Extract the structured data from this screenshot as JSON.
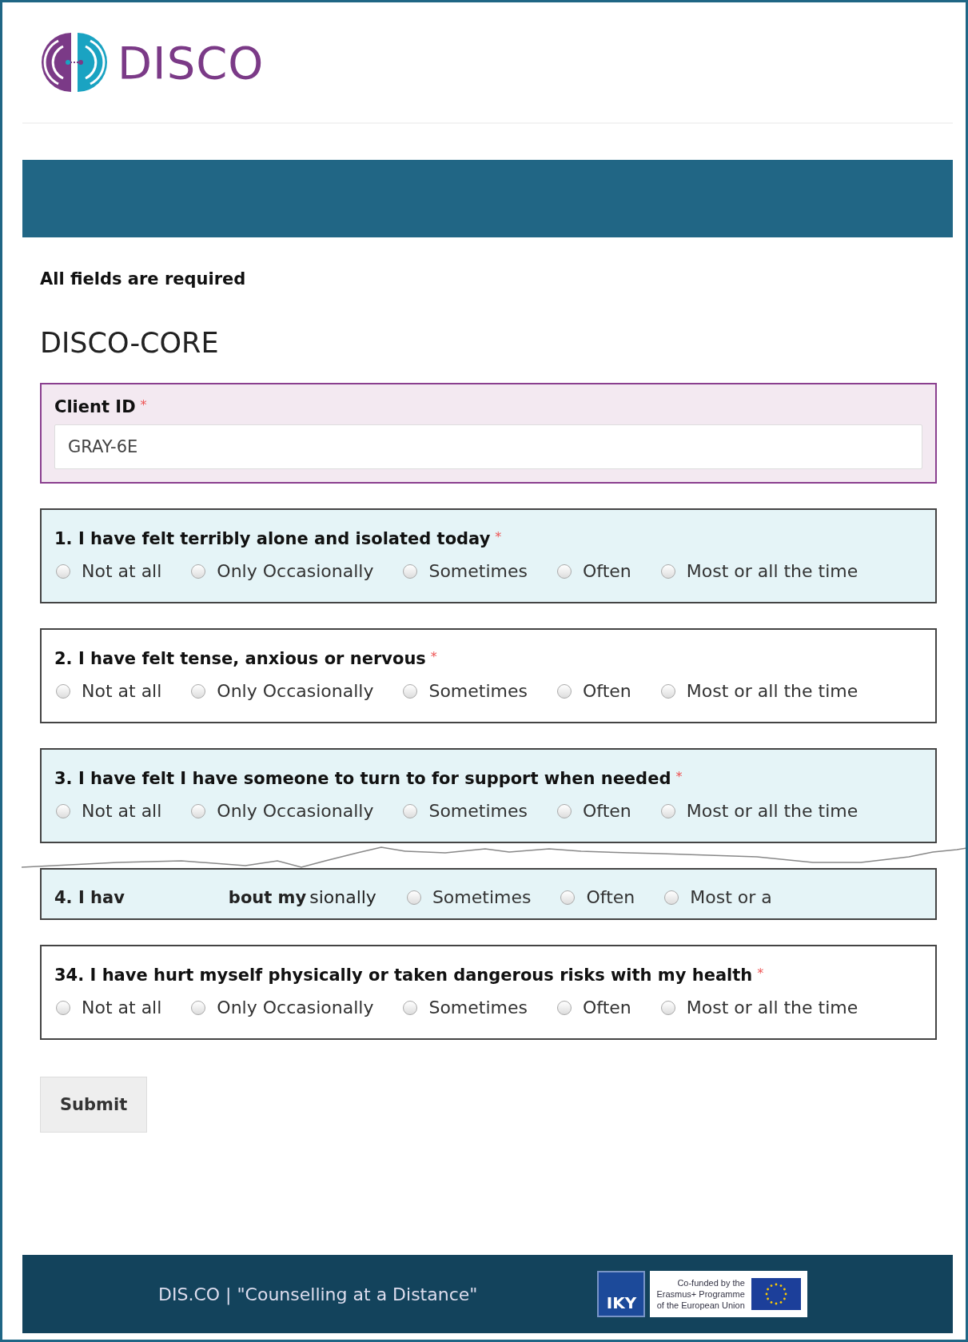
{
  "brand": {
    "name": "DISCO"
  },
  "form": {
    "required_note": "All fields are required",
    "title": "DISCO-CORE",
    "client_id": {
      "label": "Client ID",
      "required_mark": "*",
      "value": "GRAY-6E"
    },
    "questions": [
      {
        "kind": "full",
        "shaded": true,
        "title": "1. I have felt terribly alone and isolated today",
        "required_mark": "*",
        "options": [
          {
            "label": "Not at all",
            "selected": false
          },
          {
            "label": "Only Occasionally",
            "selected": false
          },
          {
            "label": "Sometimes",
            "selected": false
          },
          {
            "label": "Often",
            "selected": false
          },
          {
            "label": "Most or all the time",
            "selected": false
          }
        ]
      },
      {
        "kind": "full",
        "shaded": false,
        "title": "2. I have felt tense, anxious or nervous",
        "required_mark": "*",
        "options": [
          {
            "label": "Not at all",
            "selected": false
          },
          {
            "label": "Only Occasionally",
            "selected": false
          },
          {
            "label": "Sometimes",
            "selected": false
          },
          {
            "label": "Often",
            "selected": false
          },
          {
            "label": "Most or all the time",
            "selected": false
          }
        ]
      },
      {
        "kind": "full",
        "shaded": true,
        "title": "3. I have felt I have someone to turn to for support when needed",
        "required_mark": "*",
        "options": [
          {
            "label": "Not at all",
            "selected": false
          },
          {
            "label": "Only Occasionally",
            "selected": false
          },
          {
            "label": "Sometimes",
            "selected": false
          },
          {
            "label": "Often",
            "selected": false
          },
          {
            "label": "Most or all the time",
            "selected": false
          }
        ]
      },
      {
        "kind": "torn",
        "shaded": true,
        "fragments": [
          "4. I hav",
          "bout my",
          "sionally"
        ],
        "options": [
          {
            "label": "Sometimes",
            "selected": false
          },
          {
            "label": "Often",
            "selected": false
          },
          {
            "label": "Most or a",
            "selected": false
          }
        ]
      },
      {
        "kind": "full",
        "shaded": false,
        "title": "34. I have hurt myself physically or taken dangerous risks with my health",
        "required_mark": "*",
        "options": [
          {
            "label": "Not at all",
            "selected": false
          },
          {
            "label": "Only Occasionally",
            "selected": false
          },
          {
            "label": "Sometimes",
            "selected": false
          },
          {
            "label": "Often",
            "selected": false
          },
          {
            "label": "Most or all the time",
            "selected": false
          }
        ]
      }
    ],
    "submit": "Submit"
  },
  "footer": {
    "text": "DIS.CO | \"Counselling at a Distance\"",
    "iky_logo": "IKY",
    "eu_note": [
      "Co-funded by the",
      "Erasmus+ Programme",
      "of the European Union"
    ]
  }
}
